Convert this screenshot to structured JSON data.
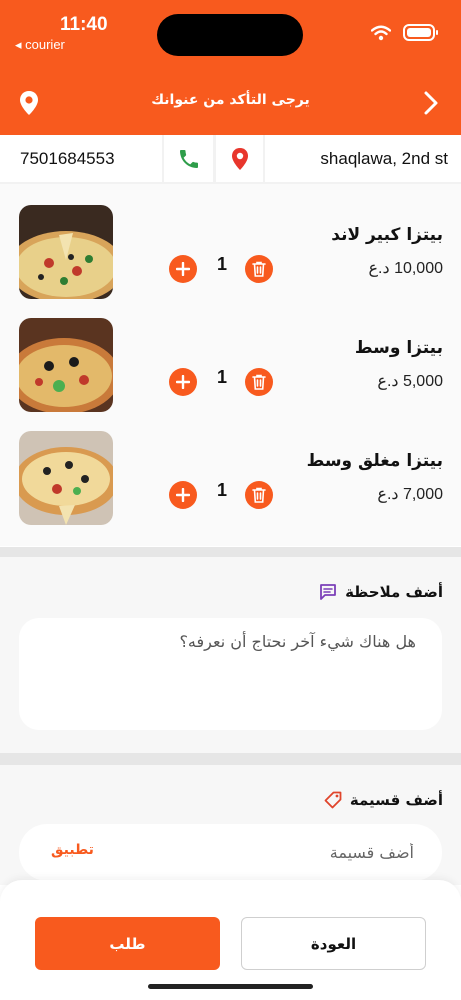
{
  "status_bar": {
    "time": "11:40",
    "back_app": "◂ courier"
  },
  "header": {
    "title": "يرجى التأكد من عنوانك",
    "accent_color": "#f85a1e"
  },
  "address": {
    "phone": "7501684553",
    "street": "shaqlawa, 2nd st"
  },
  "cart": {
    "items": [
      {
        "name": "بيتزا كبير لاند",
        "price": "10,000 د.ع",
        "qty": "1",
        "image": "pizza-image"
      },
      {
        "name": "بيتزا وسط",
        "price": "5,000 د.ع",
        "qty": "1",
        "image": "pizza-image"
      },
      {
        "name": "بيتزا مغلق وسط",
        "price": "7,000 د.ع",
        "qty": "1",
        "image": "pizza-image"
      }
    ]
  },
  "note": {
    "title": "أضف ملاحظة",
    "placeholder": "هل هناك شيء آخر نحتاج أن نعرفه؟",
    "icon": "chat-icon"
  },
  "coupon": {
    "title": "أضف قسيمة",
    "placeholder": "أضف قسيمة",
    "apply_label": "تطبيق",
    "icon": "tag-icon"
  },
  "actions": {
    "order_label": "طلب",
    "back_label": "العودة"
  }
}
